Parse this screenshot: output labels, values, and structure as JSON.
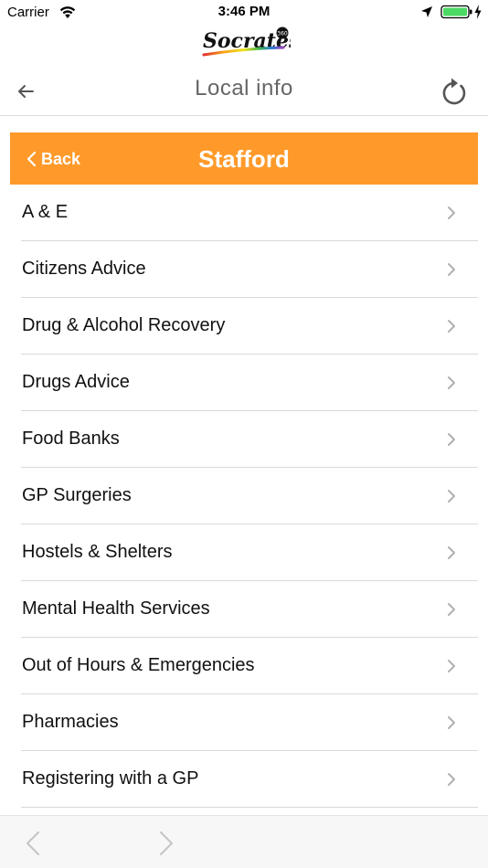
{
  "status_bar": {
    "carrier": "Carrier",
    "time": "3:46 PM",
    "icons": [
      "wifi-icon",
      "location-arrow-icon",
      "battery-icon",
      "charging-bolt-icon"
    ]
  },
  "logo": {
    "text": "Socrates",
    "badge": "360"
  },
  "nav": {
    "title": "Local info",
    "back_icon": "arrow-left-icon",
    "refresh_icon": "refresh-icon"
  },
  "section": {
    "back_label": "Back",
    "title": "Stafford",
    "background_color": "#ff9a2a"
  },
  "items": [
    {
      "label": "A & E"
    },
    {
      "label": "Citizens Advice"
    },
    {
      "label": "Drug & Alcohol Recovery"
    },
    {
      "label": "Drugs Advice"
    },
    {
      "label": "Food Banks"
    },
    {
      "label": "GP Surgeries"
    },
    {
      "label": "Hostels & Shelters"
    },
    {
      "label": "Mental Health Services"
    },
    {
      "label": "Out of Hours & Emergencies"
    },
    {
      "label": "Pharmacies"
    },
    {
      "label": "Registering with a GP"
    }
  ],
  "toolbar": {
    "back_icon": "chevron-left-icon",
    "forward_icon": "chevron-right-icon"
  }
}
